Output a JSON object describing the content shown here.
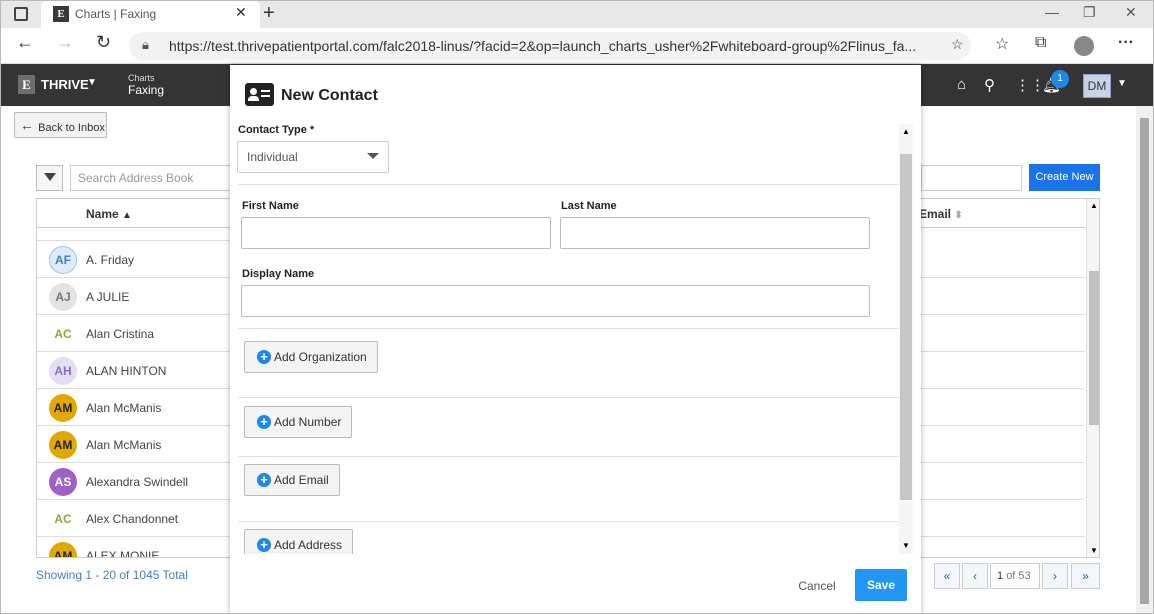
{
  "browser": {
    "tab_title": "Charts | Faxing",
    "url": "https://test.thrivepatientportal.com/falc2018-linus/?facid=2&op=launch_charts_usher%2Fwhiteboard-group%2Flinus_fa..."
  },
  "app": {
    "brand": "THRIVE",
    "logo_letter": "E",
    "breadcrumb_parent": "Charts",
    "breadcrumb_current": "Faxing",
    "notification_count": "1",
    "user_initials": "DM"
  },
  "inbox": {
    "back_label": "Back to Inbox",
    "search_placeholder": "Search Address Book",
    "create_new_label": "Create New",
    "col_name": "Name",
    "col_email": "Email",
    "showing": "Showing 1 - 20 of 1045 Total",
    "page_current": "1",
    "page_of": "of 53",
    "rows": [
      {
        "initials": "AF",
        "name": "A. Friday",
        "bg": "#dcebf8",
        "fg": "#3f7fc1",
        "ring": true
      },
      {
        "initials": "AJ",
        "name": "A JULIE",
        "bg": "#e3e3e3",
        "fg": "#777"
      },
      {
        "initials": "AC",
        "name": "Alan Cristina",
        "bg": "transparent",
        "fg": "#8ca83a"
      },
      {
        "initials": "AH",
        "name": "ALAN HINTON",
        "bg": "#e4dff0",
        "fg": "#8a6bc1"
      },
      {
        "initials": "AM",
        "name": "Alan McManis",
        "bg": "#e0a800",
        "fg": "#222"
      },
      {
        "initials": "AM",
        "name": "Alan McManis",
        "bg": "#e0a800",
        "fg": "#222"
      },
      {
        "initials": "AS",
        "name": "Alexandra Swindell",
        "bg": "#9e62c6",
        "fg": "#fff"
      },
      {
        "initials": "AC",
        "name": "Alex Chandonnet",
        "bg": "transparent",
        "fg": "#8ca83a"
      },
      {
        "initials": "AM",
        "name": "ALEX MONIE",
        "bg": "#e0a800",
        "fg": "#222"
      }
    ]
  },
  "modal": {
    "title": "New Contact",
    "contact_type_label": "Contact Type *",
    "contact_type_value": "Individual",
    "first_name_label": "First Name",
    "last_name_label": "Last Name",
    "display_name_label": "Display Name",
    "add_organization": "Add Organization",
    "add_number": "Add Number",
    "add_email": "Add Email",
    "add_address": "Add Address",
    "cancel": "Cancel",
    "save": "Save"
  }
}
